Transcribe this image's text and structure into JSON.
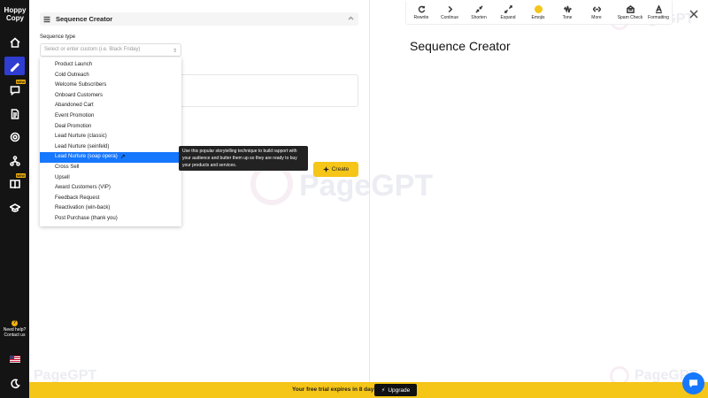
{
  "brand": {
    "logo_line1": "Hoppy",
    "logo_line2": "Copy"
  },
  "nav": {
    "new_badge": "NEW",
    "help_line1": "Need help?",
    "help_line2": "Contact us"
  },
  "panel": {
    "title": "Sequence Creator",
    "sequence_type_label": "Sequence type",
    "select_placeholder": "Select or enter custom (i.e. Black Friday)",
    "create_label": "Create"
  },
  "dropdown": {
    "items": [
      "Product Launch",
      "Cold Outreach",
      "Welcome Subscribers",
      "Onboard Customers",
      "Abandoned Cart",
      "Event Promotion",
      "Deal Promotion",
      "Lead Nurture (classic)",
      "Lead Nurture (seinfeld)",
      "Lead Nurture (soap opera)",
      "Cross Sell",
      "Upsell",
      "Award Customers (VIP)",
      "Feedback Request",
      "Reactivation (win-back)",
      "Post Purchase (thank you)"
    ],
    "selected_index": 9
  },
  "tooltip": {
    "text": "Use this popular storytelling technique to build rapport with your audience and butter them up so they are ready to buy your products and services."
  },
  "toolbar": {
    "rewrite": "Rewrite",
    "continue": "Continue",
    "shorten": "Shorten",
    "expand": "Expand",
    "emojis": "Emojis",
    "tone": "Tone",
    "more": "More",
    "spam_check": "Spam Check",
    "formatting": "Formatting"
  },
  "editor": {
    "title": "Sequence Creator"
  },
  "watermark": {
    "text": "PageGPT"
  },
  "bottom": {
    "trial_text": "Your free trial expires in 8 days",
    "upgrade_label": "Upgrade"
  },
  "colors": {
    "accent_blue": "#1677ff",
    "brand_yellow": "#f5c518",
    "nav_bg": "#141414",
    "active_nav": "#2f3dd1"
  }
}
